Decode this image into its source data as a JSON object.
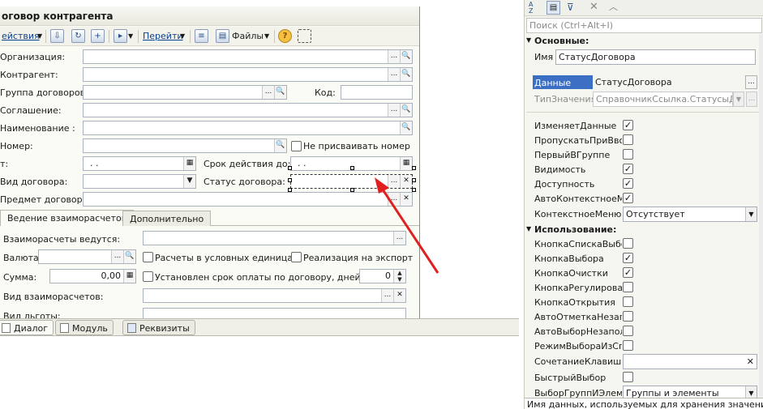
{
  "form": {
    "title": "оговор контрагента",
    "toolbar": {
      "actions": "ействия",
      "goto": "Перейти",
      "files": "Файлы"
    },
    "fields": {
      "organization": "Организация:",
      "counterparty": "Контрагент:",
      "contract_group": "Группа договоров:",
      "code": "Код:",
      "agreement": "Соглашение:",
      "name": "Наименование :",
      "number": "Номер:",
      "no_assign_number": "Не присваивать номер",
      "from": "т:",
      "date_placeholder": ". .",
      "validity": "Срок действия до:",
      "contract_kind": "Вид договора:",
      "contract_status": "Статус договора:",
      "subject": "Предмет договора:"
    },
    "tabs": [
      "Ведение взаиморасчетов",
      "Дополнительно"
    ],
    "settlements": {
      "conducted": "Взаиморасчеты ведутся:",
      "currency": "Валюта:",
      "conventional_units": "Расчеты в условных единицах",
      "export": "Реализация на экспорт",
      "sum": "Сумма:",
      "sum_value": "0,00",
      "payment_term": "Установлен срок оплаты по договору, дней",
      "days_value": "0",
      "settlement_kind": "Вид взаиморасчетов:",
      "benefit_kind": "Вид льготы:"
    }
  },
  "bottom_tabs": [
    "Диалог",
    "Модуль",
    "Реквизиты"
  ],
  "properties": {
    "search_placeholder": "Поиск (Ctrl+Alt+I)",
    "sections": {
      "basic": "Основные:",
      "usage": "Использование:"
    },
    "name_label": "Имя",
    "name_value": "СтатусДоговора",
    "data_label": "Данные",
    "data_value": "СтатусДоговора",
    "type_label": "ТипЗначения",
    "type_value": "СправочникСсылка.СтатусыДого",
    "basic_flags": [
      {
        "label": "ИзменяетДанные",
        "checked": true
      },
      {
        "label": "ПропускатьПриВводе",
        "checked": false
      },
      {
        "label": "ПервыйВГруппе",
        "checked": false
      },
      {
        "label": "Видимость",
        "checked": true
      },
      {
        "label": "Доступность",
        "checked": true
      },
      {
        "label": "АвтоКонтекстноеМеню",
        "checked": true
      }
    ],
    "context_menu_label": "КонтекстноеМеню",
    "context_menu_value": "Отсутствует",
    "usage_flags": [
      {
        "label": "КнопкаСпискаВыбора",
        "checked": false
      },
      {
        "label": "КнопкаВыбора",
        "checked": true
      },
      {
        "label": "КнопкаОчистки",
        "checked": true
      },
      {
        "label": "КнопкаРегулирования",
        "checked": false
      },
      {
        "label": "КнопкаОткрытия",
        "checked": false
      },
      {
        "label": "АвтоОтметкаНезаполненного",
        "checked": false
      },
      {
        "label": "АвтоВыборНезаполненного",
        "checked": false
      },
      {
        "label": "РежимВыбораИзСписка",
        "checked": false
      }
    ],
    "hotkey_label": "СочетаниеКлавиш",
    "quick_choice_label": "БыстрыйВыбор",
    "group_choice_label": "ВыборГруппИЭлементов",
    "group_choice_value": "Группы и элементы",
    "description": "Имя данных, используемых для хранения значений,"
  },
  "colors": {
    "accent": "#2f5fa6",
    "arrow": "#e02020",
    "selected_row": "#3a6fc4"
  }
}
